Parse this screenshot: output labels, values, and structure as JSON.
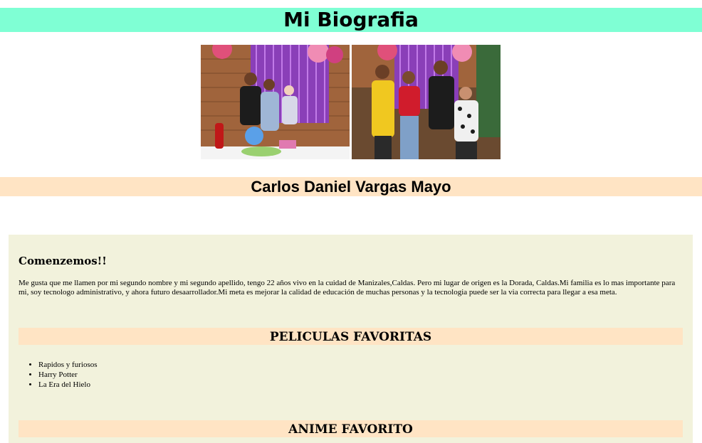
{
  "header": {
    "title": "Mi Biografia"
  },
  "photos": [
    {
      "name": "family-photo-1"
    },
    {
      "name": "family-photo-2"
    }
  ],
  "profile": {
    "name": "Carlos Daniel Vargas Mayo"
  },
  "intro": {
    "heading": "Comenzemos!!",
    "text": "Me gusta que me llamen por mi segundo nombre y mi segundo apellido, tengo 22 años vivo en la cuidad de Manizales,Caldas. Pero mi lugar de origen es la Dorada, Caldas.Mi familia es lo mas importante para mi, soy tecnologo administrativo, y ahora futuro desaarrollador.Mi meta es mejorar la calidad de educación de muchas personas y la tecnologia puede ser la via correcta para llegar a esa meta."
  },
  "movies": {
    "heading": "PELICULAS FAVORITAS",
    "items": [
      "Rapidos y furiosos",
      "Harry Potter",
      "La Era del Hielo"
    ]
  },
  "anime": {
    "heading": "ANIME FAVORITO"
  },
  "colors": {
    "title_bg": "#7fffd4",
    "banner_bg": "#ffe4c4",
    "content_bg": "#f2f2dc"
  }
}
